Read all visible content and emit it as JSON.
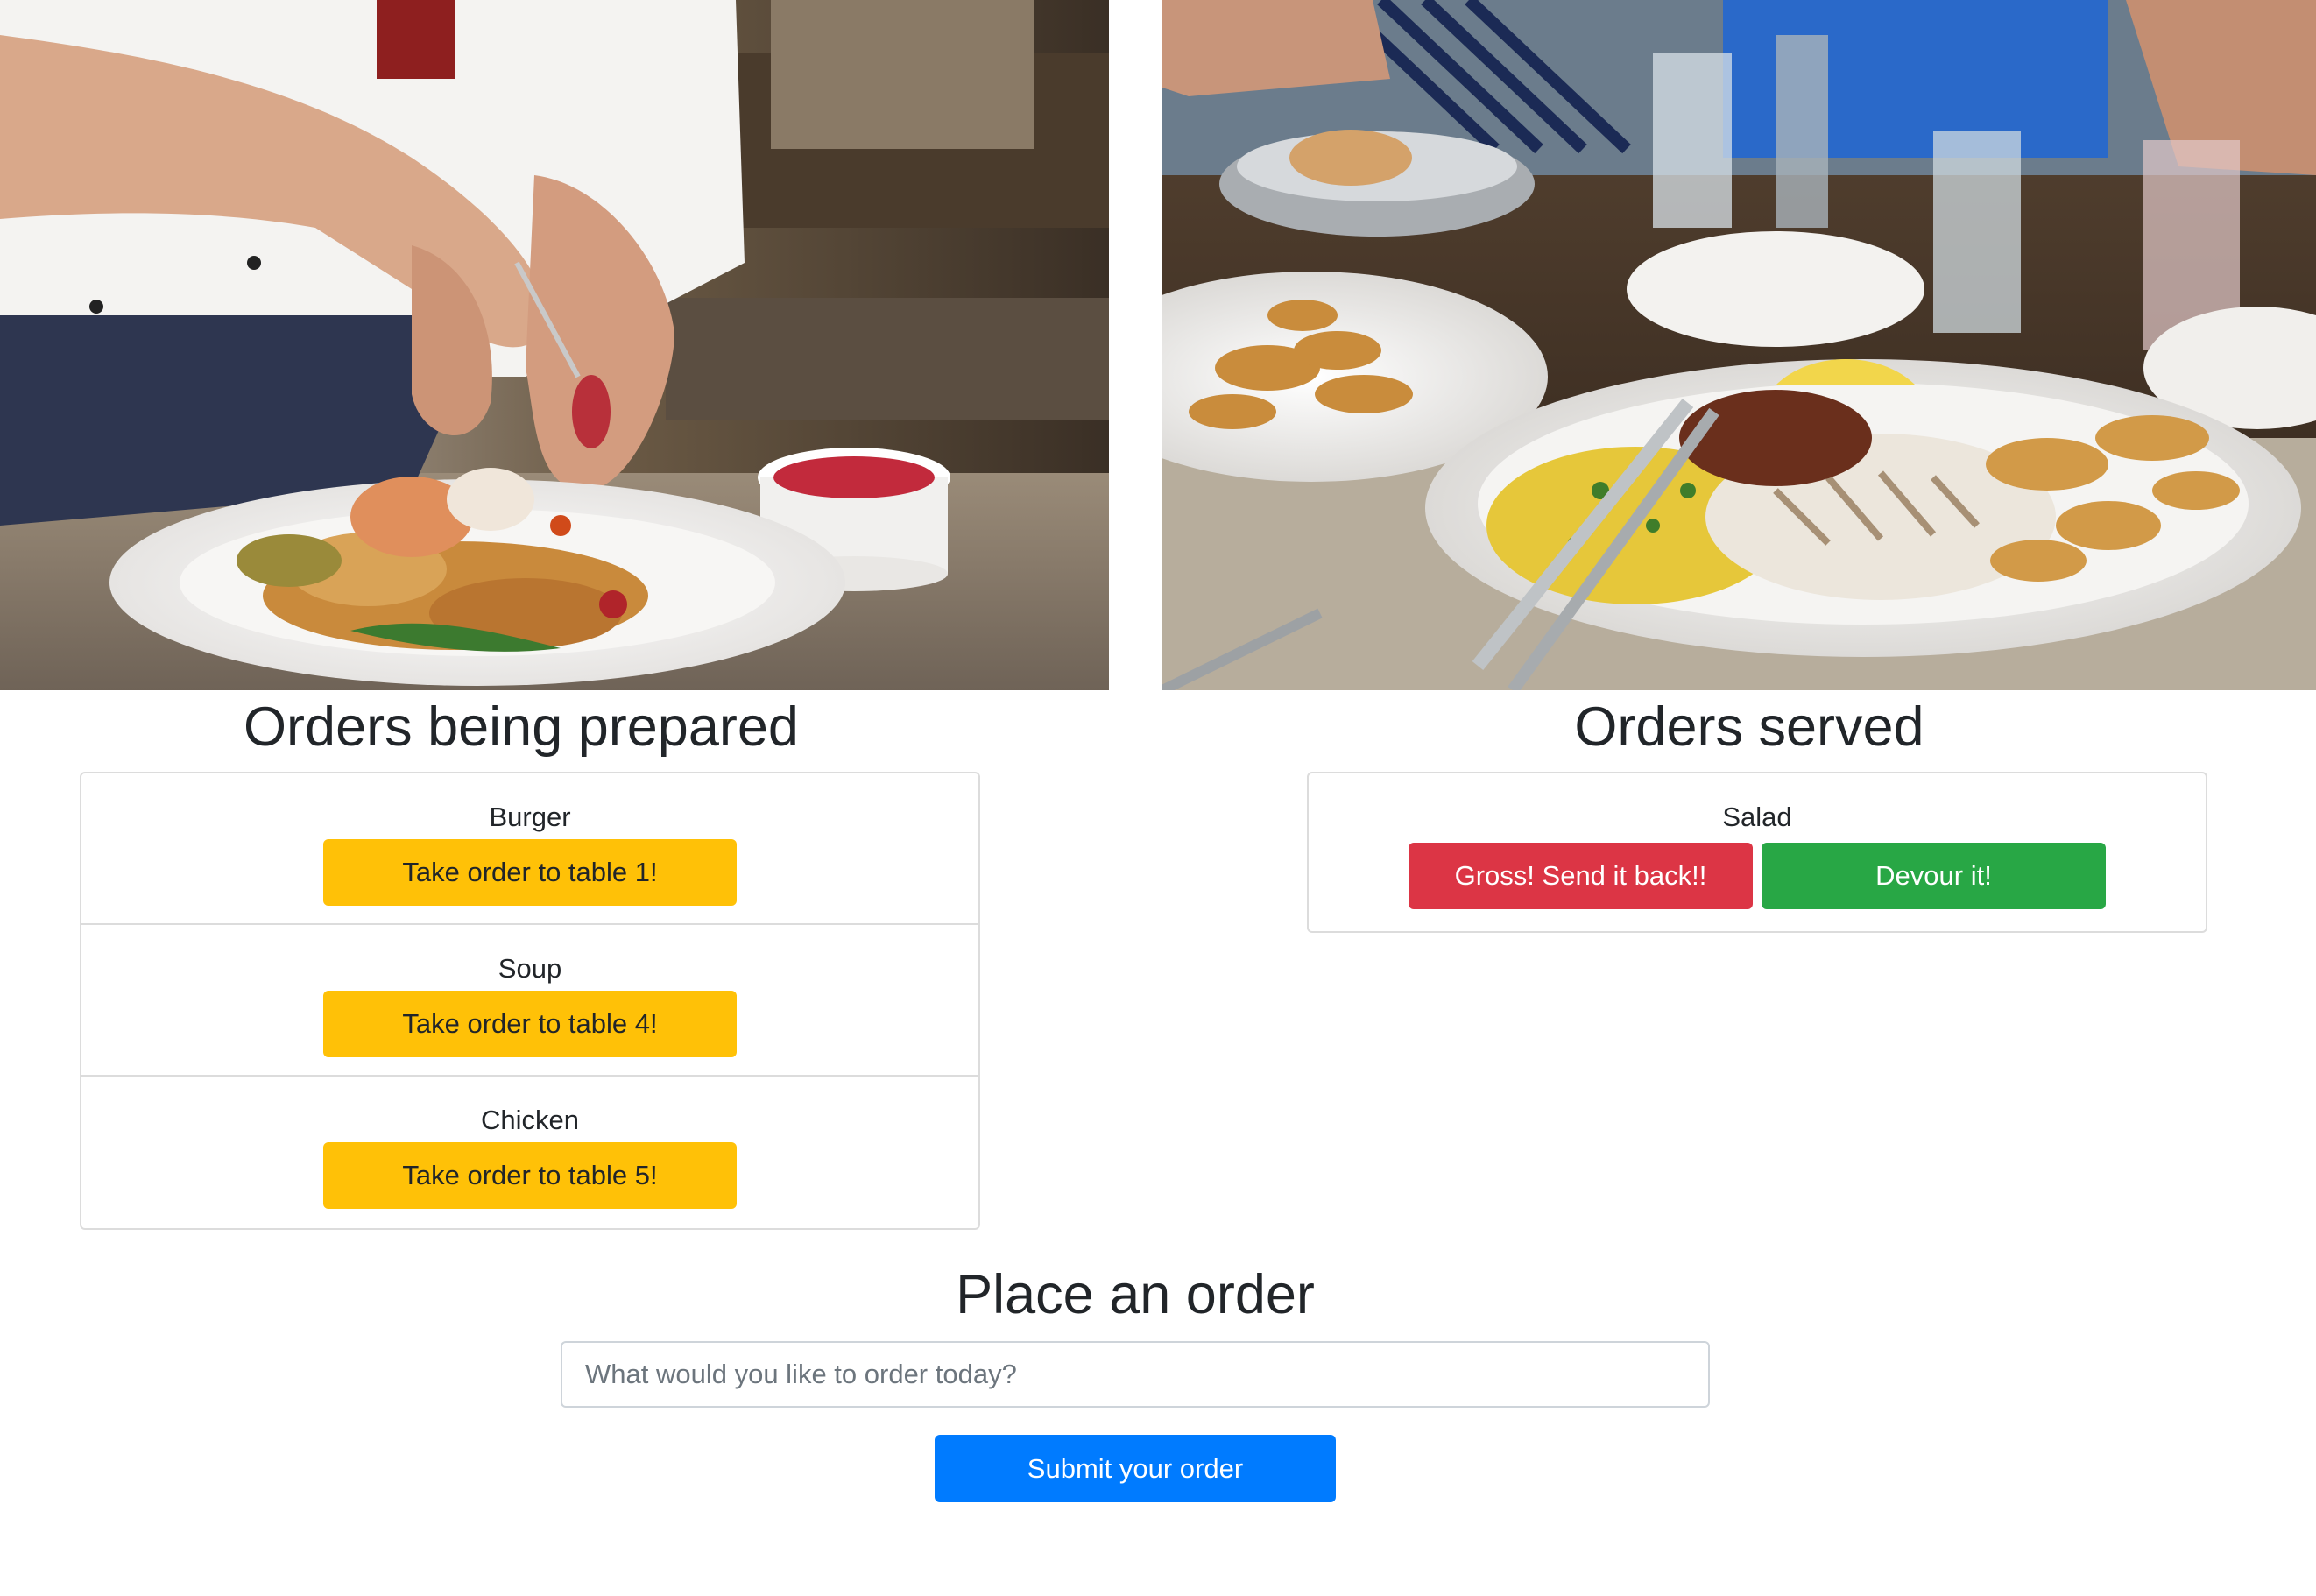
{
  "images": {
    "left_photo": "chef-plating-dish-photo",
    "right_photo": "seafood-platter-table-photo"
  },
  "preparing": {
    "title": "Orders being prepared",
    "items": [
      {
        "name": "Burger",
        "button_label": "Take order to table 1!"
      },
      {
        "name": "Soup",
        "button_label": "Take order to table 4!"
      },
      {
        "name": "Chicken",
        "button_label": "Take order to table 5!"
      }
    ]
  },
  "served": {
    "title": "Orders served",
    "items": [
      {
        "name": "Salad",
        "reject_label": "Gross! Send it back!!",
        "accept_label": "Devour it!"
      }
    ]
  },
  "order_form": {
    "title": "Place an order",
    "input_value": "",
    "input_placeholder": "What would you like to order today?",
    "submit_label": "Submit your order"
  },
  "colors": {
    "warning": "#ffc107",
    "danger": "#dc3545",
    "success": "#28a745",
    "primary": "#007bff",
    "text": "#212529",
    "border": "#dcdcdc"
  }
}
